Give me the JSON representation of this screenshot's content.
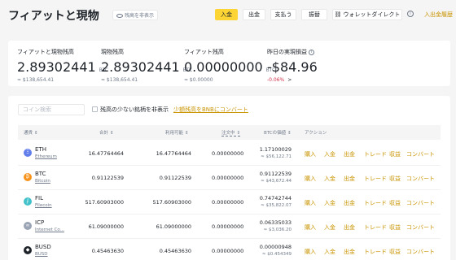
{
  "header": {
    "title": "フィアットと現物",
    "hide_balance": "残高を非表示",
    "buttons": {
      "deposit": "入金",
      "withdraw": "出金",
      "pay": "支払う",
      "transfer": "振替",
      "wallet_direct": "ウォレットダイレクト"
    },
    "history_link": "入出金履歴"
  },
  "summary": {
    "total": {
      "label": "フィアットと現物残高",
      "value": "2.89302441",
      "unit": "BTC",
      "sub": "≈ $138,654.41"
    },
    "spot": {
      "label": "現物残高",
      "value": "2.89302441",
      "unit": "BTC",
      "sub": "≈ $138,654.41"
    },
    "fiat": {
      "label": "フィアット残高",
      "value": "0.00000000",
      "unit": "BTC",
      "sub": "≈ $0.00000"
    },
    "pnl": {
      "label": "昨日の実現損益",
      "value": "-$84.96",
      "sub": "-0.06%",
      "info_icon": "i"
    }
  },
  "filters": {
    "search_placeholder": "コイン検索",
    "hide_small": "残高の少ない銘柄を非表示",
    "convert_link": "少額残高をBNBにコンバート"
  },
  "table": {
    "headers": [
      "通貨",
      "合計",
      "利用可能",
      "注文中",
      "BTCの価値",
      "アクション"
    ],
    "rows": [
      {
        "symbol": "ETH",
        "name": "Ethereum",
        "total": "16.47764464",
        "available": "16.47764464",
        "in_order": "0.00000000",
        "btc_value": "1.17100029",
        "usd_value": "≈ $56,122.71",
        "color": "#627eea",
        "icon": "Ξ"
      },
      {
        "symbol": "BTC",
        "name": "Bitcoin",
        "total": "0.91122539",
        "available": "0.91122539",
        "in_order": "0.00000000",
        "btc_value": "0.91122539",
        "usd_value": "≈ $43,672.44",
        "color": "#f7931a",
        "icon": "₿"
      },
      {
        "symbol": "FIL",
        "name": "Filecoin",
        "total": "517.60903000",
        "available": "517.60903000",
        "in_order": "0.00000000",
        "btc_value": "0.74742744",
        "usd_value": "≈ $35,822.07",
        "color": "#42c1ca",
        "icon": "⨍"
      },
      {
        "symbol": "ICP",
        "name": "Internet Co...",
        "total": "61.09000000",
        "available": "61.09000000",
        "in_order": "0.00000000",
        "btc_value": "0.06335033",
        "usd_value": "≈ $3,036.20",
        "color": "#9aa4b5",
        "icon": "∞"
      },
      {
        "symbol": "BUSD",
        "name": "BUSD",
        "total": "0.45463630",
        "available": "0.45463630",
        "in_order": "0.00000000",
        "btc_value": "0.00000948",
        "usd_value": "≈ $0.454349",
        "color": "#1e2329",
        "icon": "◆"
      }
    ],
    "actions": [
      "購入",
      "入金",
      "出金",
      "トレード",
      "収益",
      "コンバート"
    ]
  }
}
